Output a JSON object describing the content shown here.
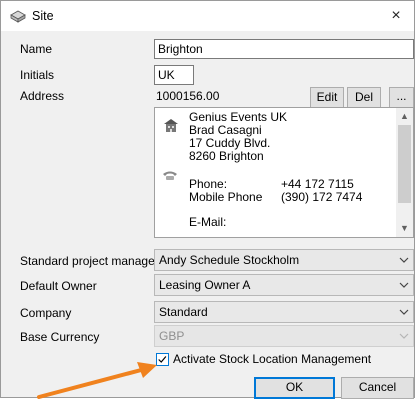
{
  "window": {
    "title": "Site",
    "close_glyph": "×"
  },
  "fields": {
    "name": {
      "label": "Name",
      "value": "Brighton"
    },
    "initials": {
      "label": "Initials",
      "value": "UK"
    },
    "address": {
      "label": "Address",
      "code": "1000156.00",
      "edit_label": "Edit",
      "del_label": "Del",
      "more_label": "...",
      "lines": [
        "Genius Events UK",
        "Brad Casagni",
        "17 Cuddy Blvd.",
        "8260 Brighton"
      ],
      "phone_label": "Phone:",
      "phone_value": "+44 172 7115",
      "mobile_label": "Mobile Phone",
      "mobile_value": "(390) 172 7474",
      "email_label": "E-Mail:"
    },
    "standard_project_manager": {
      "label": "Standard project manager",
      "value": "Andy Schedule Stockholm"
    },
    "default_owner": {
      "label": "Default Owner",
      "value": "Leasing Owner A"
    },
    "company": {
      "label": "Company",
      "value": "Standard"
    },
    "base_currency": {
      "label": "Base Currency",
      "value": "GBP"
    }
  },
  "checkbox": {
    "label": "Activate Stock Location Management",
    "checked": true
  },
  "buttons": {
    "ok": "OK",
    "cancel": "Cancel"
  },
  "colors": {
    "accent": "#0078d7",
    "annotation_arrow": "#f0821e",
    "dialog_bg": "#f0f0f0"
  },
  "icons": {
    "title": "site-building-icon",
    "address_card": "building-icon",
    "contact": "telephone-icon"
  }
}
